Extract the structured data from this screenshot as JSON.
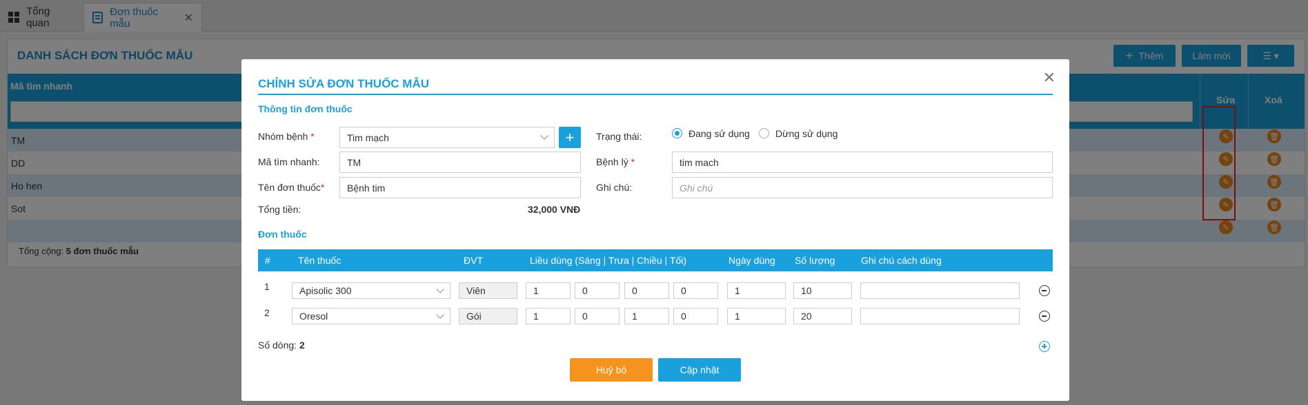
{
  "tabs": [
    {
      "label": "Tổng quan"
    },
    {
      "label": "Đơn thuốc mẫu"
    }
  ],
  "page": {
    "title": "DANH SÁCH ĐƠN THUỐC MẪU",
    "add_label": "Thêm",
    "refresh_label": "Làm mới",
    "col_code": "Mã tìm nhanh",
    "col_edit": "Sửa",
    "col_delete": "Xoá",
    "rows": [
      "TM",
      "DD",
      "Ho hen",
      "Sot",
      ""
    ],
    "total_label": "Tổng cộng:",
    "total_value": "5 đơn thuốc mẫu"
  },
  "modal": {
    "title": "CHỈNH SỬA ĐƠN THUỐC MẪU",
    "section_info": "Thông tin đơn thuốc",
    "group_label": "Nhóm bệnh",
    "group_value": "Tim mạch",
    "code_label": "Mã tìm nhanh:",
    "code_value": "TM",
    "name_label": "Tên đơn thuốc",
    "name_value": "Bệnh tim",
    "total_label": "Tổng tiền:",
    "total_value": "32,000 VNĐ",
    "status_label": "Trạng thái:",
    "status_active": "Đang sử dụng",
    "status_inactive": "Dừng sử dụng",
    "disease_label": "Bệnh lý",
    "disease_value": "tim mach",
    "note_label": "Ghi chú:",
    "note_placeholder": "Ghi chú",
    "section_drugs": "Đơn thuốc",
    "headers": {
      "num": "#",
      "drug": "Tên thuốc",
      "unit": "ĐVT",
      "dose": "Liều dùng (Sáng | Trưa | Chiều | Tối)",
      "days": "Ngày dùng",
      "qty": "Số lượng",
      "note": "Ghi chú cách dùng"
    },
    "drugs": [
      {
        "num": "1",
        "name": "Apisolic 300",
        "unit": "Viên",
        "morning": "1",
        "noon": "0",
        "afternoon": "0",
        "night": "0",
        "days": "1",
        "qty": "10",
        "note": ""
      },
      {
        "num": "2",
        "name": "Oresol",
        "unit": "Gói",
        "morning": "1",
        "noon": "0",
        "afternoon": "1",
        "night": "0",
        "days": "1",
        "qty": "20",
        "note": ""
      }
    ],
    "row_count_label": "Số dòng:",
    "row_count": "2",
    "cancel_label": "Huỷ bỏ",
    "update_label": "Cập nhật"
  },
  "colors": {
    "accent": "#1aa0dc",
    "cancel": "#f5931e",
    "action": "#e8871e"
  }
}
